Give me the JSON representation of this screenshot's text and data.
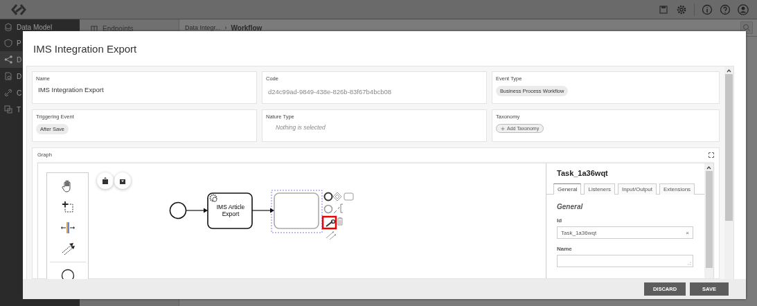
{
  "app": {
    "sidebar": [
      {
        "label": "Data Model",
        "selected": false
      },
      {
        "label": "P",
        "selected": false
      },
      {
        "label": "D",
        "selected": true
      },
      {
        "label": "D",
        "selected": false
      },
      {
        "label": "C",
        "selected": false
      },
      {
        "label": "T",
        "selected": false
      }
    ],
    "panel_item": "Endpoints",
    "breadcrumb": [
      "Data Integr...",
      "Workflow"
    ],
    "breadcrumb_separator": "›"
  },
  "modal": {
    "title": "IMS Integration Export",
    "fields": [
      {
        "label": "Name",
        "kind": "text",
        "value": "IMS Integration Export"
      },
      {
        "label": "Code",
        "kind": "readonly",
        "value": "d24c99ad-9849-438e-826b-83f67b4bcb08"
      },
      {
        "label": "Event Type",
        "kind": "tag",
        "value": "Business Process Workflow"
      },
      {
        "label": "Triggering Event",
        "kind": "tag",
        "value": "After Save"
      },
      {
        "label": "Nature Type",
        "kind": "placeholder",
        "placeholder": "Nothing is selected"
      },
      {
        "label": "Taxonomy",
        "kind": "add",
        "value": "Add Taxonomy"
      }
    ],
    "graph": {
      "label": "Graph",
      "tasks": [
        {
          "kind": "service",
          "label": "IMS Article Export",
          "selected": false
        },
        {
          "kind": "task",
          "selected": true
        }
      ],
      "highlight_box": true,
      "properties": {
        "title": "Task_1a36wqt",
        "tabs": [
          {
            "label": "General",
            "selected": true
          },
          {
            "label": "Listeners",
            "selected": false
          },
          {
            "label": "Input/Output",
            "selected": false
          },
          {
            "label": "Extensions",
            "selected": false
          }
        ],
        "section": "General",
        "fields": [
          {
            "label": "Id",
            "kind": "input",
            "value": "Task_1a36wqt",
            "clear": "×"
          },
          {
            "label": "Name",
            "kind": "textarea"
          }
        ]
      }
    },
    "buttons": [
      "DISCARD",
      "SAVE"
    ]
  }
}
